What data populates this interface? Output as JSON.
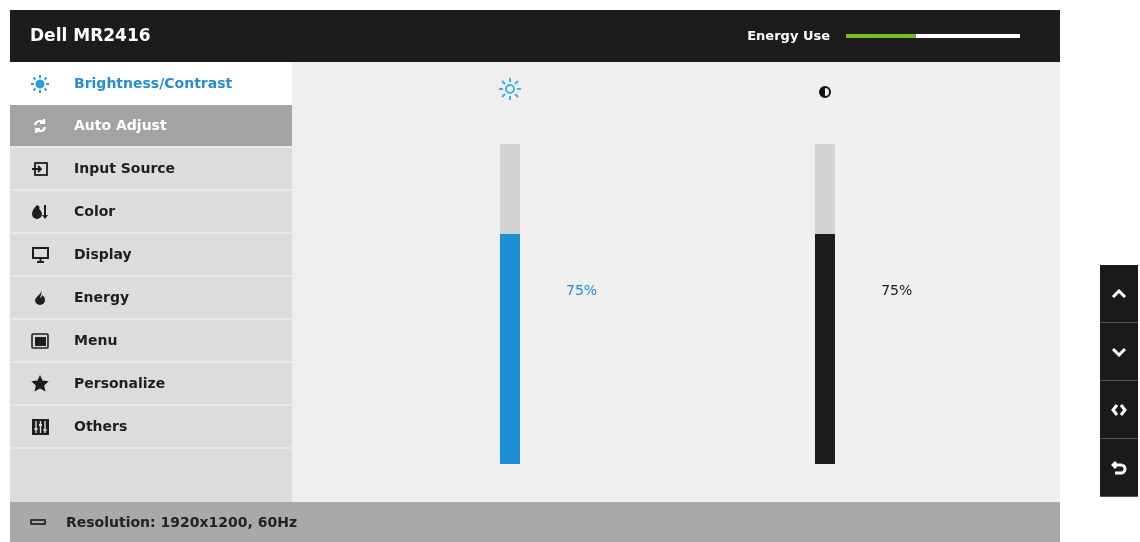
{
  "header": {
    "title": "Dell MR2416",
    "energy_label": "Energy Use",
    "energy_meter": {
      "level": 0.4
    }
  },
  "menu": [
    {
      "label": "Brightness/Contrast",
      "selected": true,
      "disabled": false
    },
    {
      "label": "Auto Adjust",
      "selected": false,
      "disabled": true
    },
    {
      "label": "Input Source",
      "selected": false,
      "disabled": false
    },
    {
      "label": "Color",
      "selected": false,
      "disabled": false
    },
    {
      "label": "Display",
      "selected": false,
      "disabled": false
    },
    {
      "label": "Energy",
      "selected": false,
      "disabled": false
    },
    {
      "label": "Menu",
      "selected": false,
      "disabled": false
    },
    {
      "label": "Personalize",
      "selected": false,
      "disabled": false
    },
    {
      "label": "Others",
      "selected": false,
      "disabled": false
    }
  ],
  "sliders": [
    {
      "kind": "brightness",
      "level": 0.72,
      "reading": "75%"
    },
    {
      "kind": "contrast",
      "level": 0.72,
      "reading": "75%"
    }
  ],
  "status_bar": {
    "text": "Resolution: 1920x1200, 60Hz"
  },
  "side_buttons": [
    {
      "kind": "up"
    },
    {
      "kind": "down"
    },
    {
      "kind": "select"
    },
    {
      "kind": "back"
    }
  ]
}
